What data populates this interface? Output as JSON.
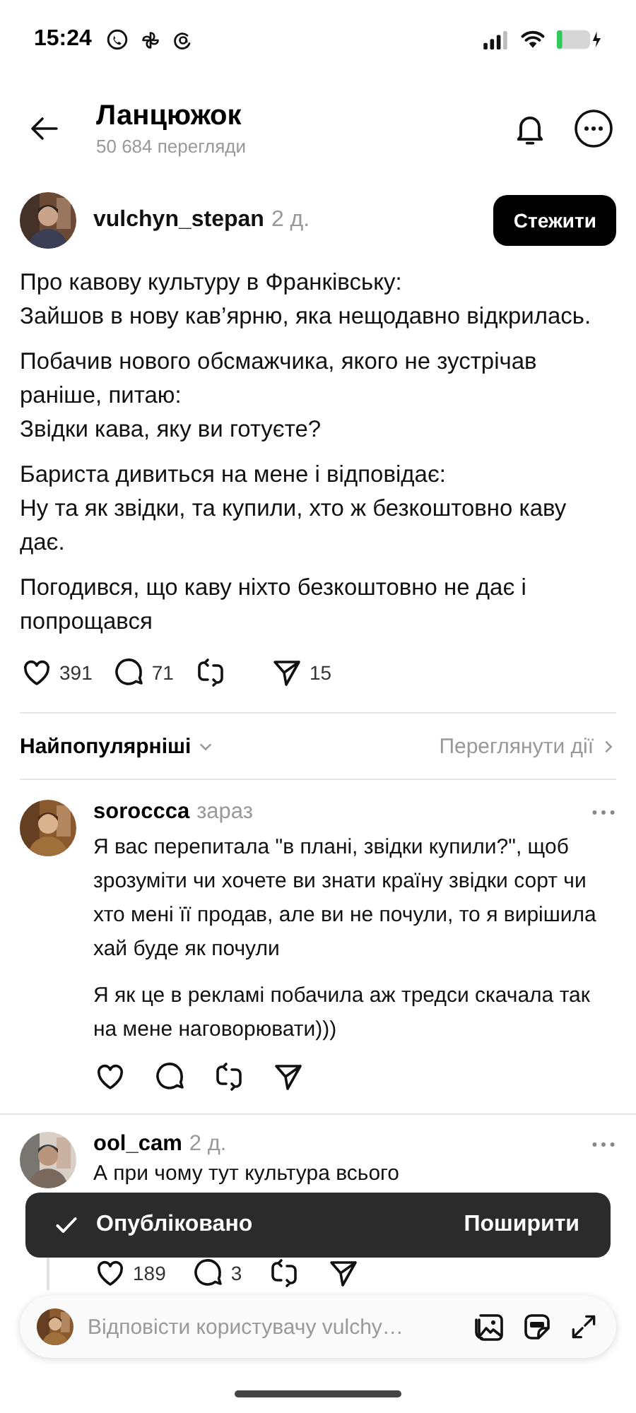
{
  "status_bar": {
    "time": "15:24"
  },
  "header": {
    "title": "Ланцюжок",
    "subtitle": "50 684 перегляди"
  },
  "post": {
    "author": "vulchyn_stepan",
    "time": "2 д.",
    "follow_label": "Стежити",
    "paragraphs": [
      "Про кавову культуру в Франківську:\nЗайшов в нову кав’ярню, яка нещодавно відкрилась.",
      "Побачив нового обсмажчика, якого не зустрічав раніше, питаю:\nЗвідки кава, яку ви готуєте?",
      "Бариста дивиться на мене і відповідає:\nНу та як звідки, та купили, хто ж безкоштовно каву дає.",
      "Погодився, що каву ніхто безкоштовно не дає і попрощався"
    ],
    "likes": "391",
    "replies": "71",
    "shares": "15"
  },
  "sort": {
    "label": "Найпопулярніші",
    "activity_link": "Переглянути дії"
  },
  "comments": [
    {
      "author": "soroccca",
      "time": "зараз",
      "thread_line": false,
      "paragraphs": [
        "Я вас перепитала \"в плані, звідки купили?\", щоб зрозуміти чи хочете ви знати країну звідки сорт чи хто мені її продав, але ви не почули, то я вирішила хай буде як почули",
        "Я як це в рекламі побачила аж тредси скачала так на мене наговорювати)))"
      ]
    },
    {
      "author": "ool_cam",
      "time": "2 д.",
      "thread_line": true,
      "paragraphs": [
        "А при чому тут культура всього"
      ],
      "likes": "189",
      "replies": "3"
    }
  ],
  "toast": {
    "message": "Опубліковано",
    "action": "Поширити"
  },
  "reply_bar": {
    "placeholder": "Відповісти користувачу vulchy…"
  }
}
